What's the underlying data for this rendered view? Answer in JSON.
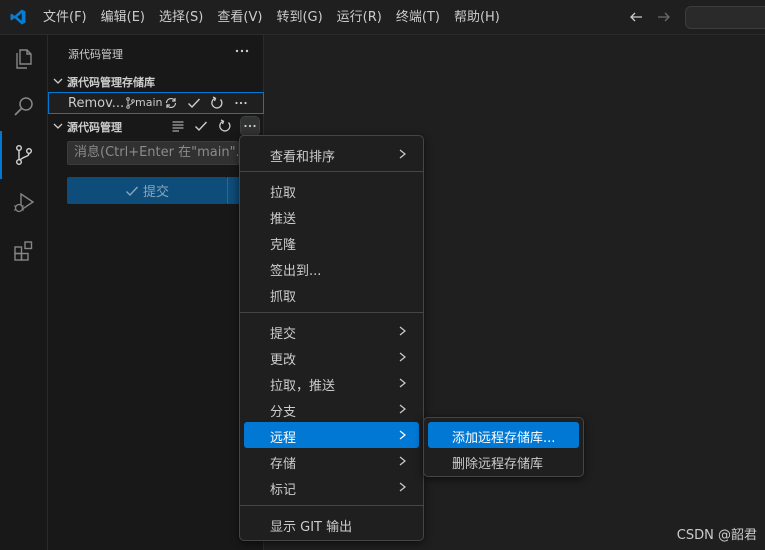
{
  "titlebar": {
    "menu": [
      "文件(F)",
      "编辑(E)",
      "选择(S)",
      "查看(V)",
      "转到(G)",
      "运行(R)",
      "终端(T)",
      "帮助(H)"
    ],
    "logo_icon": "vscode-logo",
    "nav_back_icon": "arrow-left-icon",
    "nav_forward_icon": "arrow-right-icon"
  },
  "activity_bar": {
    "items": [
      "explorer",
      "search",
      "source-control",
      "run-debug",
      "extensions"
    ],
    "active": "source-control",
    "accent": "#0078d4"
  },
  "sidebar": {
    "title": "源代码管理",
    "repos_section": "源代码管理存储库",
    "repo": {
      "name": "Remov...",
      "branch": "main"
    },
    "scm_section": "源代码管理",
    "message_placeholder": "消息(Ctrl+Enter 在\"main\"...",
    "commit_label": "提交"
  },
  "context_menu": {
    "group1": [
      {
        "label": "查看和排序",
        "submenu": true
      }
    ],
    "group2": [
      {
        "label": "拉取",
        "submenu": false
      },
      {
        "label": "推送",
        "submenu": false
      },
      {
        "label": "克隆",
        "submenu": false
      },
      {
        "label": "签出到...",
        "submenu": false
      },
      {
        "label": "抓取",
        "submenu": false
      }
    ],
    "group3": [
      {
        "label": "提交",
        "submenu": true
      },
      {
        "label": "更改",
        "submenu": true
      },
      {
        "label": "拉取，推送",
        "submenu": true
      },
      {
        "label": "分支",
        "submenu": true
      },
      {
        "label": "远程",
        "submenu": true,
        "highlighted": true
      },
      {
        "label": "存储",
        "submenu": true
      },
      {
        "label": "标记",
        "submenu": true
      }
    ],
    "group4": [
      {
        "label": "显示 GIT 输出",
        "submenu": false
      }
    ]
  },
  "submenu": {
    "items": [
      {
        "label": "添加远程存储库...",
        "highlighted": true
      },
      {
        "label": "删除远程存储库",
        "highlighted": false
      }
    ]
  },
  "watermark": "CSDN @韶君",
  "colors": {
    "highlight": "#0078d4",
    "background": "#1f1f1f",
    "sidebar": "#181818"
  }
}
